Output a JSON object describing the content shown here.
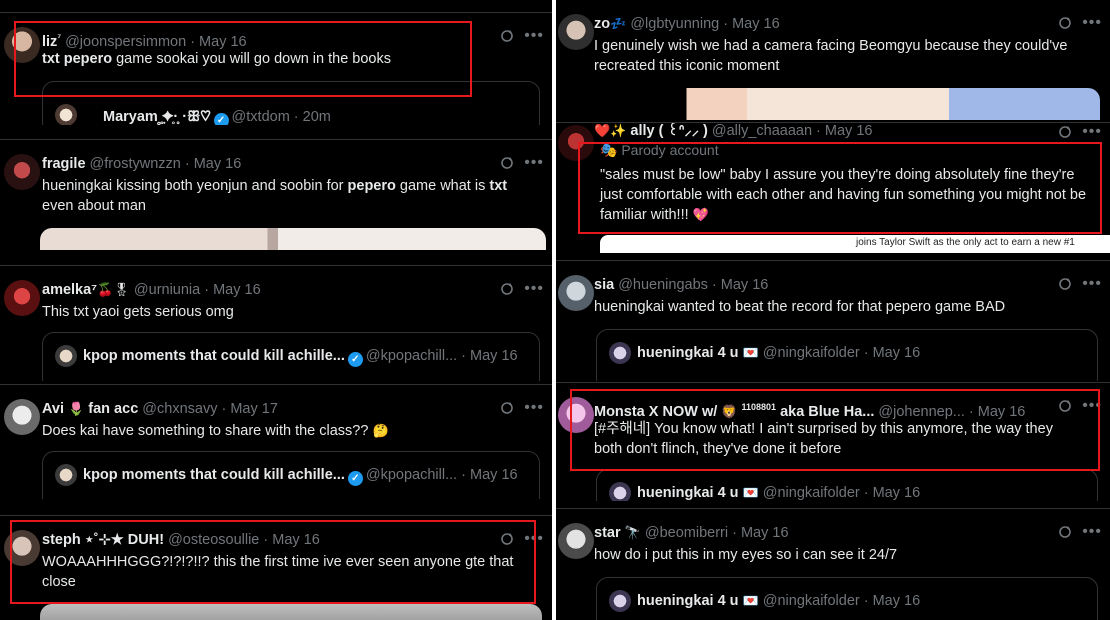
{
  "left": [
    {
      "name": "liz",
      "suffix": "⁷",
      "handle": "@joonspersimmon · May 16",
      "body_bold": "txt pepero",
      "body_rest": " game sookai you will go down in the books",
      "quote": {
        "name": "Maryam ̥̥ٜ̥✦·̥ ̥̥·ꕥ♡",
        "handle": "@txtdom · 20m"
      }
    },
    {
      "name": "fragile",
      "handle": "@frostywnzzn · May 16",
      "body_a": "hueningkai kissing both yeonjun and soobin for ",
      "body_b": "pepero",
      "body_c": " game what is ",
      "body_d": "txt",
      "body_e": " even about man"
    },
    {
      "name": "amelka⁷",
      "emoji": "🍒🎖",
      "handle": "@urniunia · May 16",
      "body": "This txt yaoi gets serious omg",
      "quote": {
        "name": "kpop moments that could kill achille...",
        "handle": "@kpopachill... · May 16"
      }
    },
    {
      "name": "Avi",
      "emoji": "🌷",
      "name2": "fan acc",
      "handle": "@chxnsavy · May 17",
      "body": "Does kai have something to share with the class??",
      "body_emoji": "🤔",
      "quote": {
        "name": "kpop moments that could kill achille...",
        "handle": "@kpopachill... · May 16"
      }
    },
    {
      "name": "steph ⋆˚⊹★ DUH!",
      "handle": "@osteosoullie · May 16",
      "body": "WOAAAHHHGGG?!?!?!!? this the first time ive ever seen anyone gte that close"
    }
  ],
  "right": [
    {
      "name": "zo",
      "emoji": "💤",
      "handle": "@lgbtyunning · May 16",
      "body": "I genuinely wish we had a camera facing Beomgyu because they could've recreated this iconic moment"
    },
    {
      "name": "ally ( ꒰ᐢ⸝⸝ )",
      "emoji": "❤️✨",
      "handle": "@ally_chaaaan · May 16",
      "parody": "Parody account",
      "body": "\"sales must be low\" baby I assure you they're doing absolutely fine they're just comfortable with each other and having fun something you might not be familiar with!!!",
      "body_emoji": "💖",
      "media_caption": "joins Taylor Swift as the only act to earn a new #1"
    },
    {
      "name": "sia",
      "handle": "@hueningabs · May 16",
      "body": "hueningkai wanted to beat the record for that pepero game BAD",
      "quote": {
        "name": "hueningkai 4 u",
        "emoji": "💌",
        "handle": "@ningkaifolder · May 16"
      }
    },
    {
      "name": "Monsta X NOW w/",
      "emoji": "🦁",
      "sup": "1108801",
      "name2": "aka Blue Ha...",
      "handle": "@johennep... · May 16",
      "body": "[#주해네] You know what! I ain't surprised by this anymore, the way they both don't flinch, they've done it before",
      "quote": {
        "name": "hueningkai 4 u",
        "emoji": "💌",
        "handle": "@ningkaifolder · May 16"
      }
    },
    {
      "name": "star",
      "emoji": "🔭",
      "handle": "@beomiberri · May 16",
      "body": "how do i put this in my eyes so i can see it 24/7",
      "quote": {
        "name": "hueningkai 4 u",
        "emoji": "💌",
        "handle": "@ningkaifolder · May 16"
      }
    }
  ],
  "colors": {
    "bg": "#000000",
    "text": "#e7e9ea",
    "muted": "#71767b",
    "highlight": "#e5181e",
    "verified": "#1d9bf0"
  },
  "icons": [
    "refresh-icon",
    "more-icon",
    "verified-badge-icon",
    "parody-mask-icon"
  ]
}
